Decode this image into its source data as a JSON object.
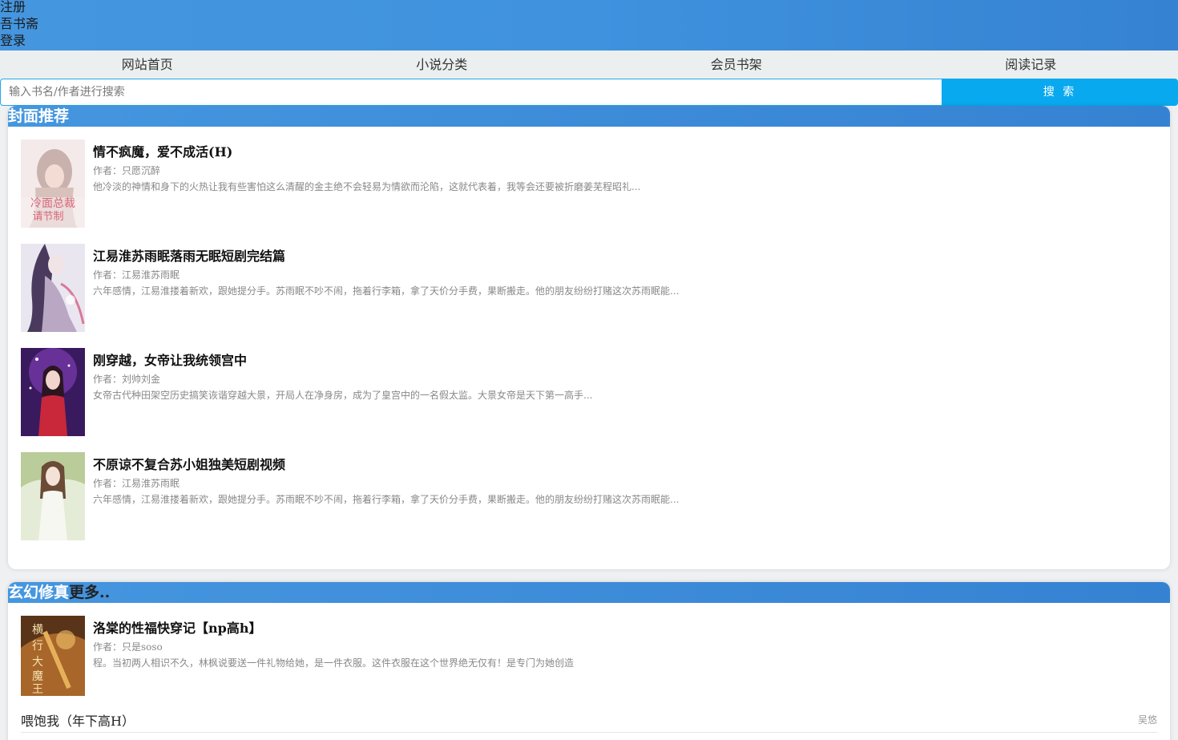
{
  "header": {
    "register": "注册",
    "site_name": "吾书斋",
    "login": "登录"
  },
  "nav": [
    "网站首页",
    "小说分类",
    "会员书架",
    "阅读记录"
  ],
  "search": {
    "placeholder": "输入书名/作者进行搜索",
    "button": "搜 索"
  },
  "section1": {
    "title": "封面推荐",
    "books": [
      {
        "title": "情不疯魔，爱不成活(H)",
        "author": "作者：只愿沉醉",
        "desc": "他冷淡的神情和身下的火热让我有些害怕这么清醒的金主绝不会轻易为情欲而沦陷，这就代表着，我等会还要被折磨姜芜程昭礼...",
        "cover_text": "冷面总裁\n请节制"
      },
      {
        "title": "江易淮苏雨眠落雨无眠短剧完结篇",
        "author": "作者：江易淮苏雨眠",
        "desc": "六年感情，江易淮搂着新欢，跟她提分手。苏雨眠不吵不闹，拖着行李箱，拿了天价分手费，果断搬走。他的朋友纷纷打赌这次苏雨眠能..."
      },
      {
        "title": "刚穿越，女帝让我统领宫中",
        "author": "作者：刘帅刘金",
        "desc": "女帝古代种田架空历史搞笑诙谐穿越大景，开局人在净身房，成为了皇宫中的一名假太监。大景女帝是天下第一高手..."
      },
      {
        "title": "不原谅不复合苏小姐独美短剧视频",
        "author": "作者：江易淮苏雨眠",
        "desc": "六年感情，江易淮搂着新欢，跟她提分手。苏雨眠不吵不闹，拖着行李箱，拿了天价分手费，果断搬走。他的朋友纷纷打赌这次苏雨眠能..."
      }
    ]
  },
  "section2": {
    "title": "玄幻修真",
    "more": "更多..",
    "featured": {
      "title": "洛棠的性福快穿记【np高h】",
      "author": "作者：只是soso",
      "desc": "程。当初两人相识不久，林枫说要送一件礼物给她，是一件衣服。这件衣服在这个世界绝无仅有！是专门为她创造",
      "cover_text": "横行大魔王"
    },
    "list": [
      {
        "title": "喂饱我（年下高H）",
        "author": "吴悠"
      }
    ]
  }
}
